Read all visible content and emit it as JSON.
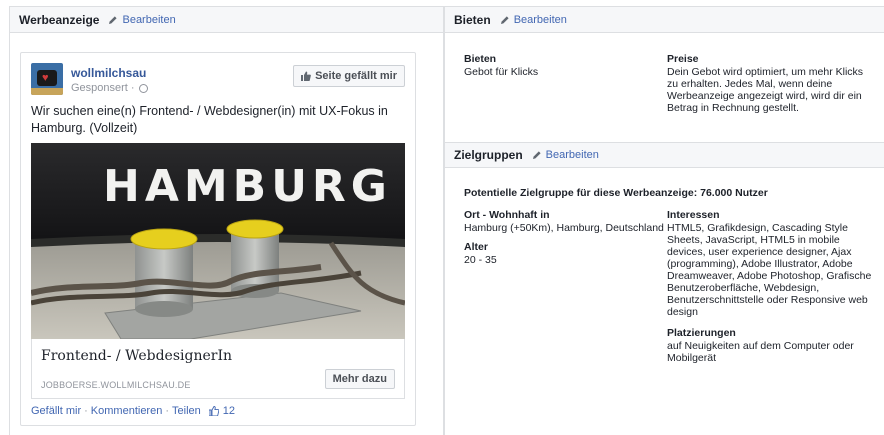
{
  "left": {
    "title": "Werbeanzeige",
    "edit_label": "Bearbeiten",
    "ad": {
      "page_name": "wollmilchsau",
      "sponsored": "Gesponsert ·",
      "like_page_button": "Seite gefällt mir",
      "text": "Wir suchen eine(n) Frontend- / Webdesigner(in) mit UX-Fokus in Hamburg. (Vollzeit)",
      "image_text": "HAMBURG",
      "headline": "Frontend- / WebdesignerIn",
      "domain": "JOBBOERSE.WOLLMILCHSAU.DE",
      "cta_button": "Mehr dazu",
      "actions": {
        "like": "Gefällt mir",
        "comment": "Kommentieren",
        "share": "Teilen",
        "like_count": "12"
      }
    }
  },
  "bieten": {
    "title": "Bieten",
    "edit_label": "Bearbeiten",
    "bid_label": "Bieten",
    "bid_value": "Gebot für Klicks",
    "price_label": "Preise",
    "price_lines": [
      "Dein Gebot wird optimiert, um mehr Klicks",
      "zu erhalten. Jedes Mal, wenn deine",
      "Werbeanzeige angezeigt wird, wird dir ein",
      "Betrag in Rechnung gestellt."
    ]
  },
  "zielgruppen": {
    "title": "Zielgruppen",
    "edit_label": "Bearbeiten",
    "audience": "Potentielle Zielgruppe für diese Werbeanzeige: 76.000 Nutzer",
    "location_label": "Ort - Wohnhaft in",
    "location_value": "Hamburg (+50Km), Hamburg, Deutschland",
    "age_label": "Alter",
    "age_value": "20 - 35",
    "interests_label": "Interessen",
    "interests_lines": [
      "HTML5, Grafikdesign, Cascading Style",
      "Sheets, JavaScript, HTML5 in mobile",
      "devices, user experience designer, Ajax",
      "(programming), Adobe Illustrator, Adobe",
      "Dreamweaver, Adobe Photoshop, Grafische",
      "Benutzeroberfläche, Webdesign,",
      "Benutzerschnittstelle oder Responsive web",
      "design"
    ],
    "placements_label": "Platzierungen",
    "placements_lines": [
      "auf Neuigkeiten auf dem Computer oder",
      "Mobilgerät"
    ]
  },
  "icons": [
    "pencil-icon",
    "thumbs-up-icon",
    "globe-icon"
  ],
  "colors": {
    "link": "#4267b2",
    "page_name": "#365899",
    "header_bg": "#f6f7f9",
    "border": "#dddfe2"
  }
}
